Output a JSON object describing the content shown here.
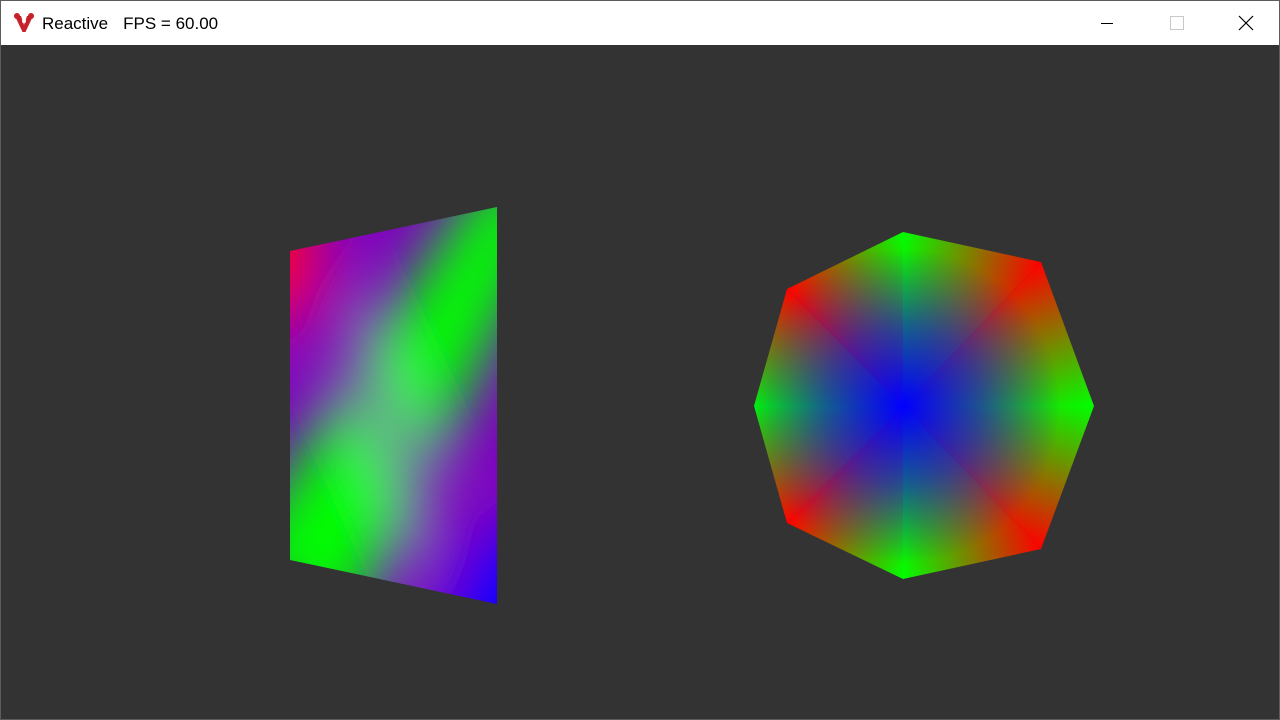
{
  "window": {
    "title": "Reactive",
    "fps_text": "FPS = 60.00",
    "app_icon": "reactive-logo-icon",
    "controls": {
      "minimize": "minimize-icon",
      "maximize": "maximize-icon",
      "close": "close-icon"
    }
  },
  "scene": {
    "background": "#333333",
    "shapes": [
      {
        "name": "quad",
        "vertex_colors": [
          "#ff0000",
          "#00ff00",
          "#0000ff",
          "#00ff00"
        ]
      },
      {
        "name": "octagon",
        "center_color": "#0000ff",
        "vertex_colors": [
          "#00ff00",
          "#ff0000"
        ]
      }
    ]
  },
  "colors": {
    "red": "#ff0000",
    "green": "#00ff00",
    "blue": "#0000ff",
    "titlebar": "#ffffff",
    "logo": "#c8202b"
  }
}
